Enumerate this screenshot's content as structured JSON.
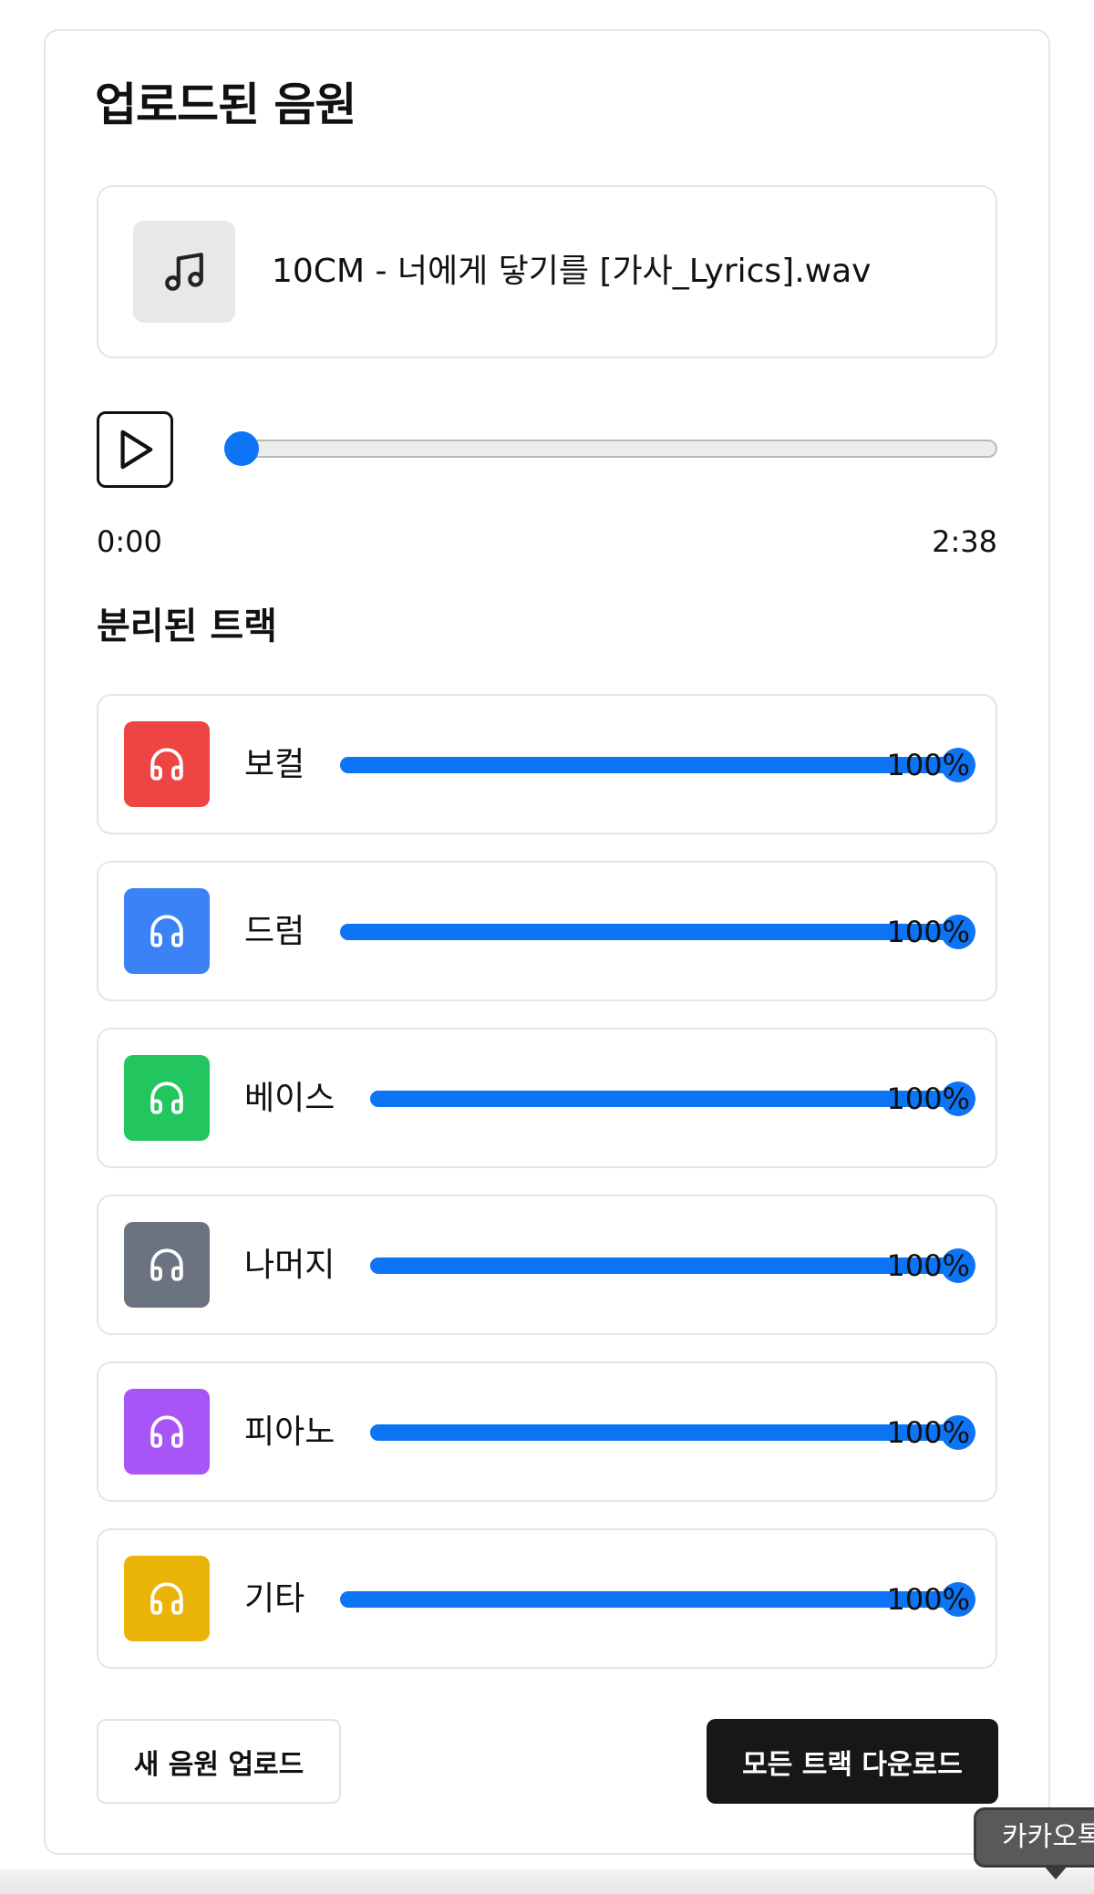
{
  "page": {
    "title": "업로드된 음원"
  },
  "file": {
    "name": "10CM - 너에게 닿기를 [가사_Lyrics].wav",
    "icon": "music-note-icon"
  },
  "player": {
    "current_time": "0:00",
    "total_time": "2:38",
    "progress_fraction": 0,
    "accent_color": "#0d74f5"
  },
  "tracks_section": {
    "title": "분리된 트랙",
    "items": [
      {
        "label": "보컬",
        "volume_text": "100%",
        "volume": 100,
        "color": "#ef4444",
        "icon": "headphones-icon"
      },
      {
        "label": "드럼",
        "volume_text": "100%",
        "volume": 100,
        "color": "#3b82f6",
        "icon": "headphones-icon"
      },
      {
        "label": "베이스",
        "volume_text": "100%",
        "volume": 100,
        "color": "#22c55e",
        "icon": "headphones-icon"
      },
      {
        "label": "나머지",
        "volume_text": "100%",
        "volume": 100,
        "color": "#6b7280",
        "icon": "headphones-icon"
      },
      {
        "label": "피아노",
        "volume_text": "100%",
        "volume": 100,
        "color": "#a855f7",
        "icon": "headphones-icon"
      },
      {
        "label": "기타",
        "volume_text": "100%",
        "volume": 100,
        "color": "#eab308",
        "icon": "headphones-icon"
      }
    ]
  },
  "actions": {
    "upload_label": "새 음원 업로드",
    "download_all_label": "모든 트랙 다운로드"
  },
  "floating_tab": {
    "label": "카카오톡"
  }
}
